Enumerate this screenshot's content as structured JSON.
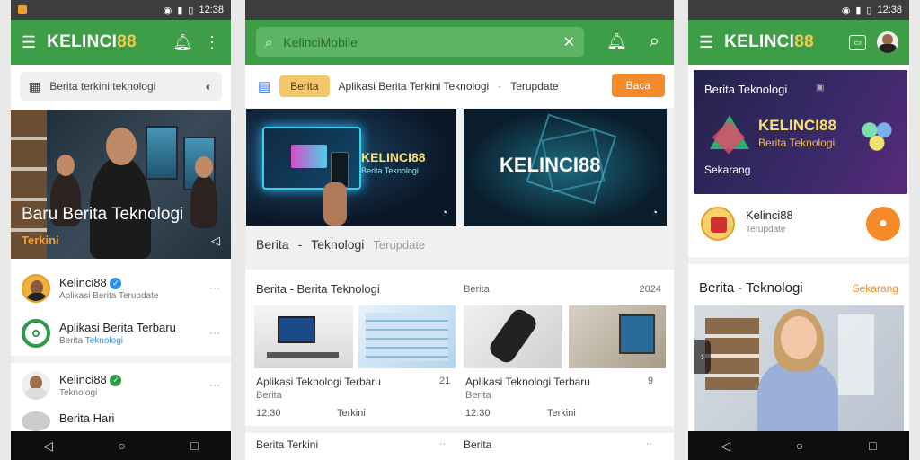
{
  "status": {
    "time": "12:38"
  },
  "panel1": {
    "brand_a": "KELINCI",
    "brand_b": "88",
    "search_placeholder": "Berita terkini teknologi",
    "hero_title": "Baru Berita Teknologi",
    "hero_sub": "Terkini",
    "items": [
      {
        "title": "Kelinci88",
        "sub": "Aplikasi Berita Terupdate"
      },
      {
        "title": "Aplikasi Berita Terbaru",
        "sub": "Berita",
        "sub2": "Teknologi"
      },
      {
        "title": "Kelinci88",
        "sub": "Teknologi"
      },
      {
        "title": "Berita Hari",
        "sub": ""
      }
    ]
  },
  "panel2": {
    "search_value": "KelinciMobile",
    "chip": "Berita",
    "chip_desc": "Aplikasi Berita Terkini Teknologi",
    "chip_tail": "Terupdate",
    "button": "Baca",
    "card1_title": "KELINCI88",
    "card1_sub": "Berita Teknologi",
    "card2_title": "KELINCI88",
    "caption_a": "Berita",
    "caption_b": "Teknologi",
    "caption_c": "Terupdate",
    "sec_title": "Berita - Berita Teknologi",
    "sec_tag": "Berita",
    "sec_count": "2024",
    "left_title": "Aplikasi Teknologi Terbaru",
    "left_num": "21",
    "left_sub": "Berita",
    "left_meta_a": "12:30",
    "left_meta_b": "Terkini",
    "right_title": "Aplikasi Teknologi Terbaru",
    "right_num": "9",
    "right_sub": "Berita",
    "right_meta_a": "12:30",
    "right_meta_b": "Terkini",
    "footer_left": "Berita Terkini",
    "footer_right": "Berita"
  },
  "panel3": {
    "brand_a": "KELINCI",
    "brand_b": "88",
    "promo_tag": "Berita Teknologi",
    "promo_title": "KELINCI88",
    "promo_sub": "Berita Teknologi",
    "promo_btn": "Sekarang",
    "app_title": "Kelinci88",
    "app_sub": "Terupdate",
    "sec_title": "Berita - Teknologi",
    "sec_link": "Sekarang"
  },
  "colors": {
    "green": "#3e9e48",
    "orange": "#f58a2a",
    "gold": "#f7c948"
  }
}
